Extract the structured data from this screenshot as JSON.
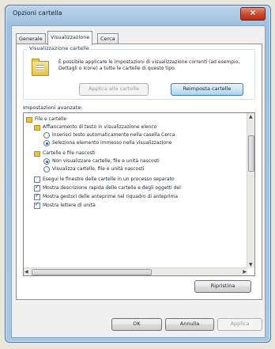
{
  "window": {
    "title": "Opzioni cartella",
    "close_glyph": "×"
  },
  "tabs": [
    {
      "label": "Generale",
      "active": false
    },
    {
      "label": "Visualizzazione",
      "active": true
    },
    {
      "label": "Cerca",
      "active": false
    }
  ],
  "folder_views": {
    "label": "Visualizzazione cartelle",
    "icon": "folder-icon",
    "description": "È possibile applicare le impostazioni di visualizzazione correnti (ad esempio, Dettagli o Icone) a tutte le cartelle di questo tipo.",
    "apply_button": "Applica alle cartelle",
    "reset_button": "Reimposta cartelle"
  },
  "advanced": {
    "label": "Impostazioni avanzate:",
    "items": [
      {
        "type": "folder",
        "text": "File e cartelle",
        "level": 0
      },
      {
        "type": "folder",
        "text": "Affiancamento di testo in visualizzazione elenco",
        "level": 1
      },
      {
        "type": "radio",
        "checked": false,
        "text": "Inserisci testo automaticamente nella casella Cerca",
        "level": 2
      },
      {
        "type": "radio",
        "checked": true,
        "text": "Seleziona elemento immesso nella visualizzazione",
        "level": 2
      },
      {
        "type": "folder",
        "text": "Cartelle e file nascosti",
        "level": 1
      },
      {
        "type": "radio",
        "checked": true,
        "text": "Non visualizzare cartelle, file e unità nascosti",
        "level": 2
      },
      {
        "type": "radio",
        "checked": false,
        "text": "Visualizza cartelle, file e unità nascosti",
        "level": 2
      },
      {
        "type": "check",
        "checked": false,
        "text": "Esegui le finestre delle cartelle in un processo separato",
        "level": 1
      },
      {
        "type": "check",
        "checked": true,
        "text": "Mostra descrizione rapida delle cartelle e degli oggetti del",
        "level": 1
      },
      {
        "type": "check",
        "checked": true,
        "text": "Mostra gestori delle anteprime nel riquadro di anteprima",
        "level": 1
      },
      {
        "type": "check",
        "checked": true,
        "text": "Mostra lettere di unità",
        "level": 1
      }
    ]
  },
  "restore_button": "Ripristina",
  "footer": {
    "ok": "OK",
    "cancel": "Annulla",
    "apply": "Applica"
  }
}
